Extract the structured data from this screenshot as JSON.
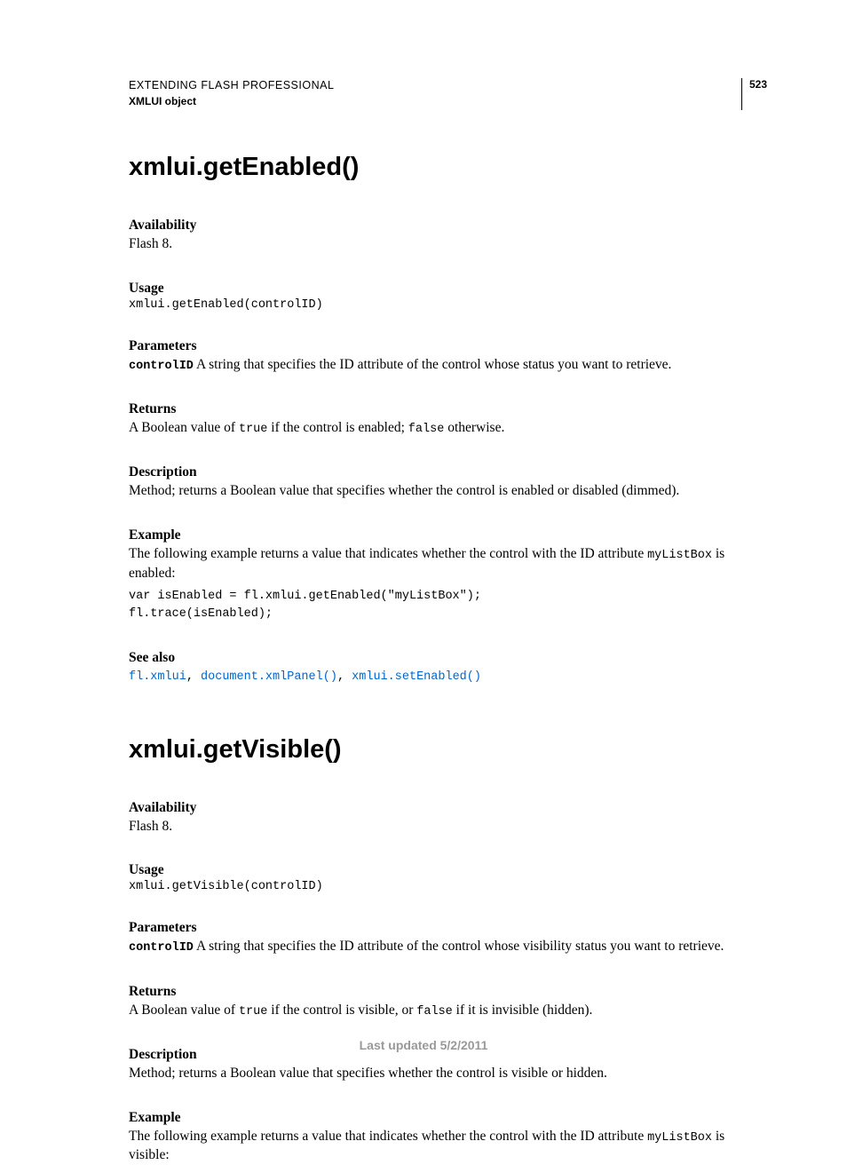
{
  "header": {
    "line1": "EXTENDING FLASH PROFESSIONAL",
    "line2": "XMLUI object",
    "page_number": "523"
  },
  "method1": {
    "title": "xmlui.getEnabled()",
    "availability": {
      "label": "Availability",
      "text": "Flash 8."
    },
    "usage": {
      "label": "Usage",
      "code": "xmlui.getEnabled(controlID)"
    },
    "parameters": {
      "label": "Parameters",
      "param_name": "controlID",
      "desc": "  A string that specifies the ID attribute of the control whose status you want to retrieve."
    },
    "returns": {
      "label": "Returns",
      "pre": "A Boolean value of ",
      "code1": "true",
      "mid": " if the control is enabled; ",
      "code2": "false",
      "post": " otherwise."
    },
    "description": {
      "label": "Description",
      "text": "Method; returns a Boolean value that specifies whether the control is enabled or disabled (dimmed)."
    },
    "example": {
      "label": "Example",
      "pre": "The following example returns a value that indicates whether the control with the ID attribute ",
      "code_inline": "myListBox",
      "post": " is enabled:",
      "code_block": "var isEnabled = fl.xmlui.getEnabled(\"myListBox\");\nfl.trace(isEnabled);"
    },
    "see_also": {
      "label": "See also",
      "link1": "fl.xmlui",
      "sep1": ", ",
      "link2": "document.xmlPanel()",
      "sep2": ", ",
      "link3": "xmlui.setEnabled()"
    }
  },
  "method2": {
    "title": "xmlui.getVisible()",
    "availability": {
      "label": "Availability",
      "text": "Flash 8."
    },
    "usage": {
      "label": "Usage",
      "code": "xmlui.getVisible(controlID)"
    },
    "parameters": {
      "label": "Parameters",
      "param_name": "controlID",
      "desc": "  A string that specifies the ID attribute of the control whose visibility status you want to retrieve."
    },
    "returns": {
      "label": "Returns",
      "pre": "A Boolean value of ",
      "code1": "true",
      "mid": " if the control is visible, or ",
      "code2": "false",
      "post": " if it is invisible (hidden)."
    },
    "description": {
      "label": "Description",
      "text": "Method; returns a Boolean value that specifies whether the control is visible or hidden."
    },
    "example": {
      "label": "Example",
      "pre": "The following example returns a value that indicates whether the control with the ID attribute ",
      "code_inline": "myListBox",
      "post": " is visible:"
    }
  },
  "footer": "Last updated 5/2/2011"
}
